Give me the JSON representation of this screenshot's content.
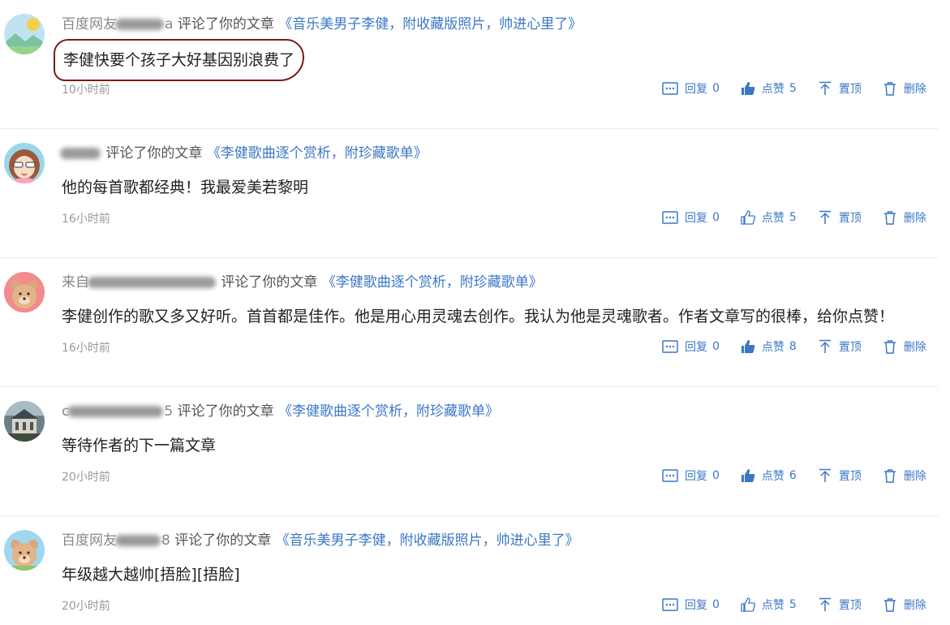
{
  "labels": {
    "commented": "评论了你的文章",
    "reply": "回复",
    "like": "点赞",
    "pin": "置顶",
    "delete": "删除"
  },
  "colors": {
    "link": "#3a77c6",
    "annotation_circle": "#7a1a1a"
  },
  "comments": [
    {
      "user_prefix": "百度网友",
      "user_suffix": "a",
      "article": "《音乐美男子李健，附收藏版照片，帅进心里了》",
      "text": "李健快要个孩子大好基因别浪费了",
      "time": "10小时前",
      "reply_count": "0",
      "like_count": "5",
      "liked": true,
      "avatar": "landscape-avatar"
    },
    {
      "user_prefix": "",
      "user_suffix": "",
      "article": "《李健歌曲逐个赏析，附珍藏歌单》",
      "text": "他的每首歌都经典！我最爱美若黎明",
      "time": "16小时前",
      "reply_count": "0",
      "like_count": "5",
      "liked": false,
      "avatar": "girl-sunglasses-avatar"
    },
    {
      "user_prefix": "来自",
      "user_suffix": "",
      "article": "《李健歌曲逐个赏析，附珍藏歌单》",
      "text": "李健创作的歌又多又好听。首首都是佳作。他是用心用灵魂去创作。我认为他是灵魂歌者。作者文章写的很棒，给你点赞！",
      "time": "16小时前",
      "reply_count": "0",
      "like_count": "8",
      "liked": true,
      "avatar": "bear-pink-avatar"
    },
    {
      "user_prefix": "c",
      "user_suffix": "5",
      "article": "《李健歌曲逐个赏析，附珍藏歌单》",
      "text": "等待作者的下一篇文章",
      "time": "20小时前",
      "reply_count": "0",
      "like_count": "6",
      "liked": true,
      "avatar": "building-photo-avatar"
    },
    {
      "user_prefix": "百度网友",
      "user_suffix": "8",
      "article": "《音乐美男子李健，附收藏版照片，帅进心里了》",
      "text": "年级越大越帅[捂脸][捂脸]",
      "time": "20小时前",
      "reply_count": "0",
      "like_count": "5",
      "liked": false,
      "avatar": "bear-blue-avatar"
    }
  ]
}
